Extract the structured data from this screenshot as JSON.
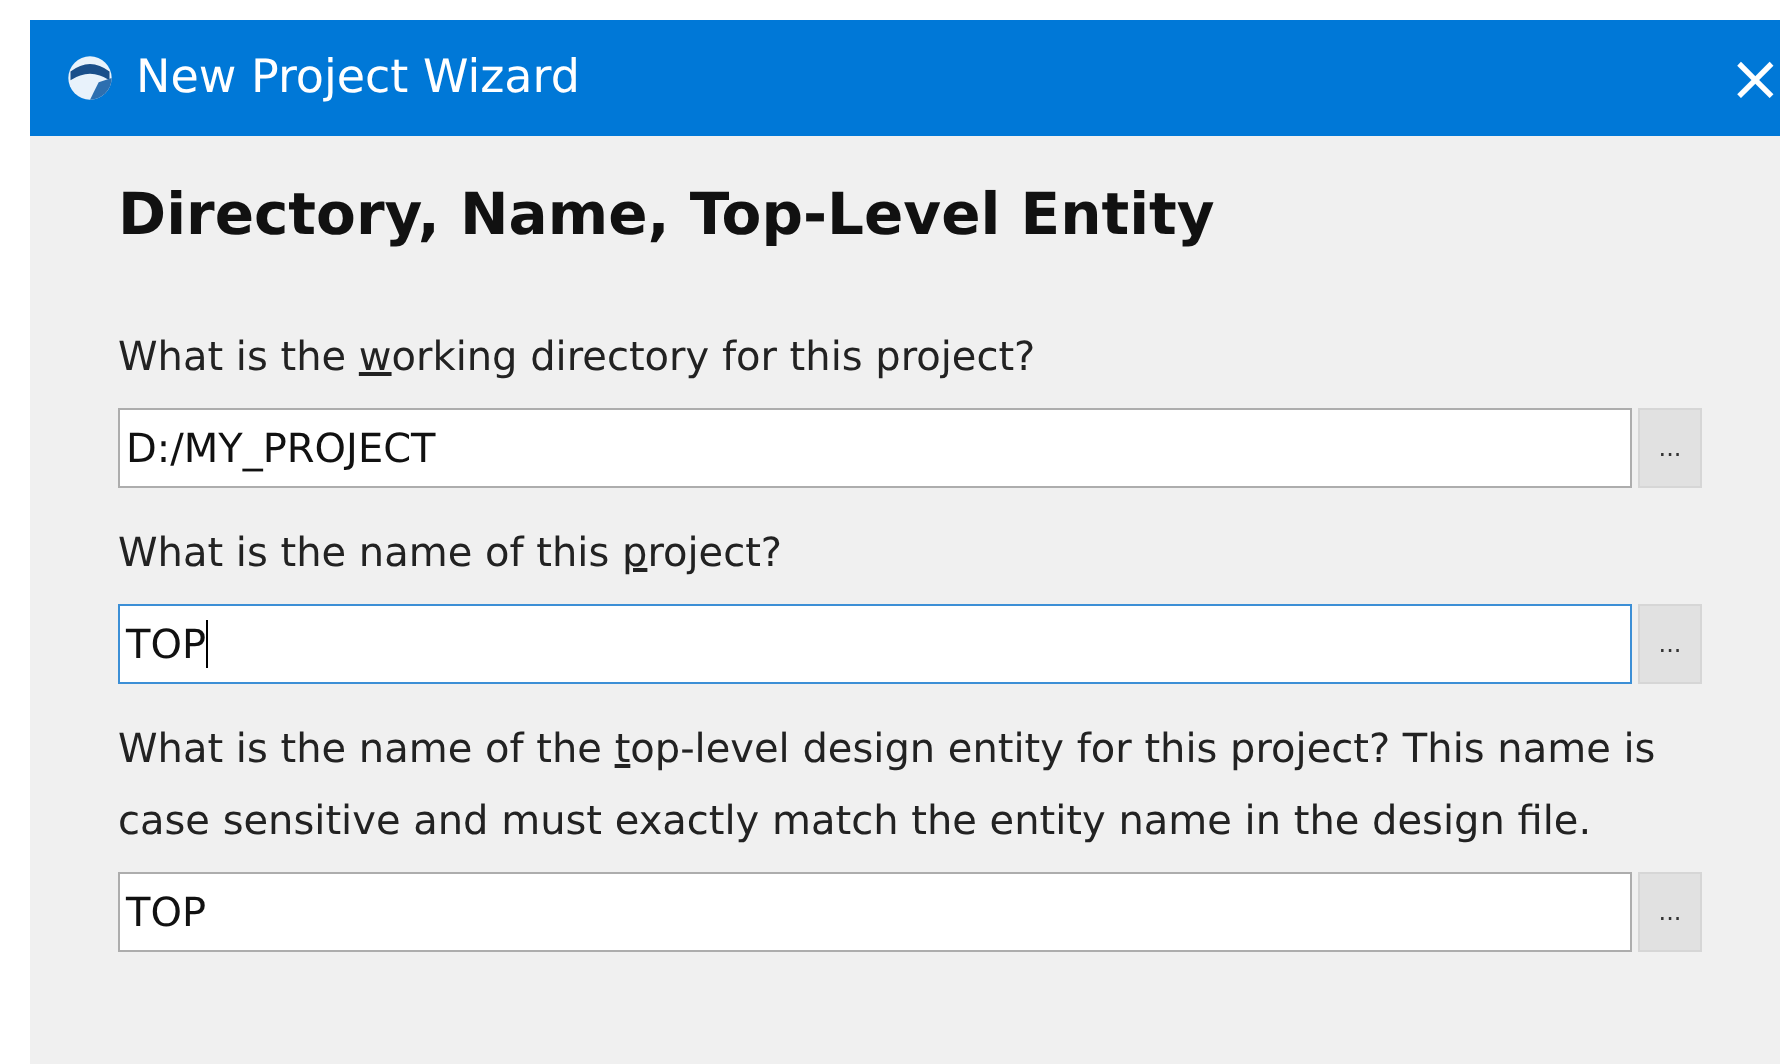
{
  "window": {
    "title": "New Project Wizard",
    "close": "×"
  },
  "heading": "Directory, Name, Top-Level Entity",
  "fields": [
    {
      "label": {
        "before": "What is the ",
        "access_key": "w",
        "after": "orking directory for this project?"
      },
      "value": "D:/MY_PROJECT",
      "focused": false,
      "browse": "..."
    },
    {
      "label": {
        "before": "What is the name of this ",
        "access_key": "p",
        "after": "roject?"
      },
      "value": "TOP",
      "focused": true,
      "browse": "..."
    },
    {
      "label": {
        "before": "What is the name of the ",
        "access_key": "t",
        "after": "op-level design entity for this project? This name is case sensitive and must exactly match the entity name in the design file."
      },
      "value": "TOP",
      "focused": false,
      "browse": "..."
    }
  ]
}
